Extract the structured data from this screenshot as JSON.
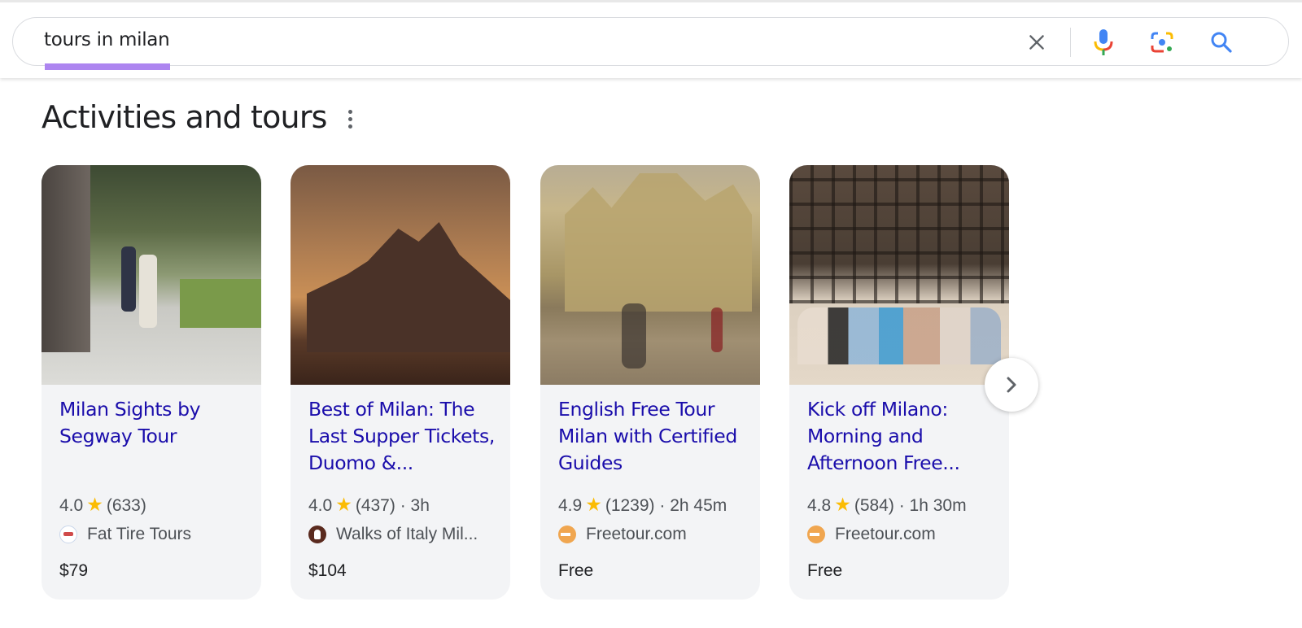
{
  "search": {
    "query": "tours in milan",
    "clear_icon": "close-icon",
    "voice_icon": "microphone-icon",
    "lens_icon": "camera-lens-icon",
    "search_icon": "search-icon"
  },
  "section": {
    "title": "Activities and tours",
    "more_icon": "more-vert-icon"
  },
  "cards": [
    {
      "title": "Milan Sights by Segway Tour",
      "rating": "4.0",
      "reviews": "(633)",
      "duration": "",
      "provider": "Fat Tire Tours",
      "price": "$79",
      "image": "segway-tour-photo"
    },
    {
      "title": "Best of Milan: The Last Supper Tickets, Duomo &...",
      "rating": "4.0",
      "reviews": "(437)",
      "duration": " · 3h",
      "provider": "Walks of Italy Mil...",
      "price": "$104",
      "image": "duomo-sunset-photo"
    },
    {
      "title": "English Free Tour Milan with Certified Guides",
      "rating": "4.9",
      "reviews": "(1239)",
      "duration": " · 2h 45m",
      "provider": "Freetour.com",
      "price": "Free",
      "image": "duomo-square-photo"
    },
    {
      "title": "Kick off Milano: Morning and Afternoon Free...",
      "rating": "4.8",
      "reviews": "(584)",
      "duration": " · 1h 30m",
      "provider": "Freetour.com",
      "price": "Free",
      "image": "group-photo-steps"
    }
  ],
  "carousel": {
    "next_icon": "chevron-right-icon"
  },
  "colors": {
    "link": "#1a0dab",
    "star": "#fbbc04",
    "underline": "#ad85f0",
    "card_bg": "#f3f4f6"
  }
}
